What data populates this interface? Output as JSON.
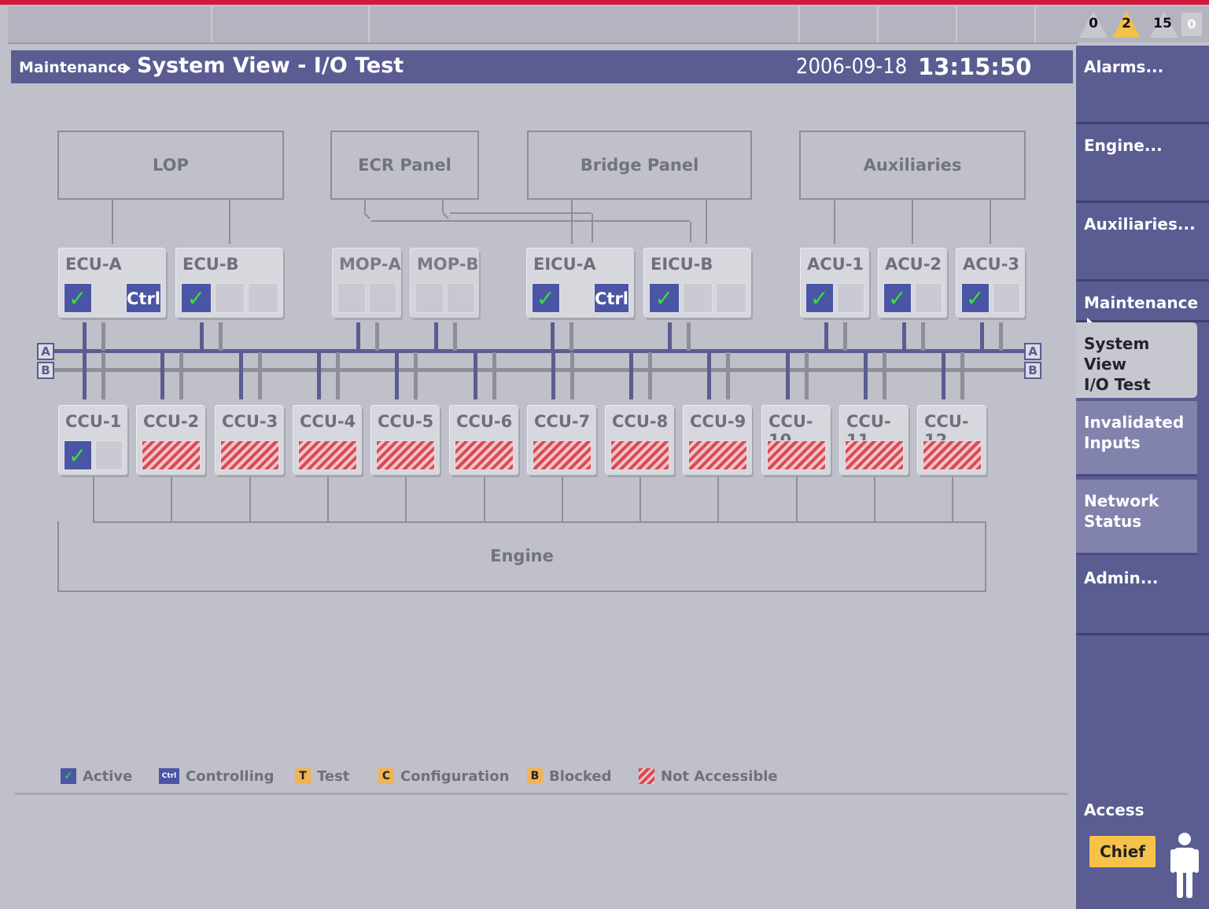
{
  "status": {
    "counter_1": "0",
    "counter_2": "2",
    "counter_3": "15",
    "counter_4": "0",
    "warning_color": "#f2c14a"
  },
  "header": {
    "breadcrumb_parent": "Maintenance",
    "title": "System View - I/O Test",
    "date": "2006-09-18",
    "time": "13:15:50"
  },
  "panels": {
    "lop": "LOP",
    "ecr": "ECR Panel",
    "bridge": "Bridge Panel",
    "aux": "Auxiliaries",
    "engine": "Engine"
  },
  "bus": {
    "a": "A",
    "b": "B"
  },
  "units_top": [
    {
      "label": "ECU-A"
    },
    {
      "label": "ECU-B"
    },
    {
      "label": "MOP-A"
    },
    {
      "label": "MOP-B"
    },
    {
      "label": "EICU-A"
    },
    {
      "label": "EICU-B"
    },
    {
      "label": "ACU-1"
    },
    {
      "label": "ACU-2"
    },
    {
      "label": "ACU-3"
    }
  ],
  "ctrl_label": "Ctrl",
  "units_ccu": [
    "CCU-1",
    "CCU-2",
    "CCU-3",
    "CCU-4",
    "CCU-5",
    "CCU-6",
    "CCU-7",
    "CCU-8",
    "CCU-9",
    "CCU-10",
    "CCU-11",
    "CCU-12"
  ],
  "legend": {
    "active": "Active",
    "controlling": "Controlling",
    "controlling_icon": "Ctrl",
    "test": "Test",
    "test_icon": "T",
    "configuration": "Configuration",
    "configuration_icon": "C",
    "blocked": "Blocked",
    "blocked_icon": "B",
    "not_accessible": "Not Accessible"
  },
  "sidebar": {
    "alarms": "Alarms...",
    "engine": "Engine...",
    "auxiliaries": "Auxiliaries...",
    "maintenance": "Maintenance",
    "system_view_1": "System View",
    "system_view_2": "I/O Test",
    "invalidated_1": "Invalidated",
    "invalidated_2": "Inputs",
    "network_1": "Network",
    "network_2": "Status",
    "admin": "Admin...",
    "access": "Access",
    "access_level": "Chief"
  }
}
